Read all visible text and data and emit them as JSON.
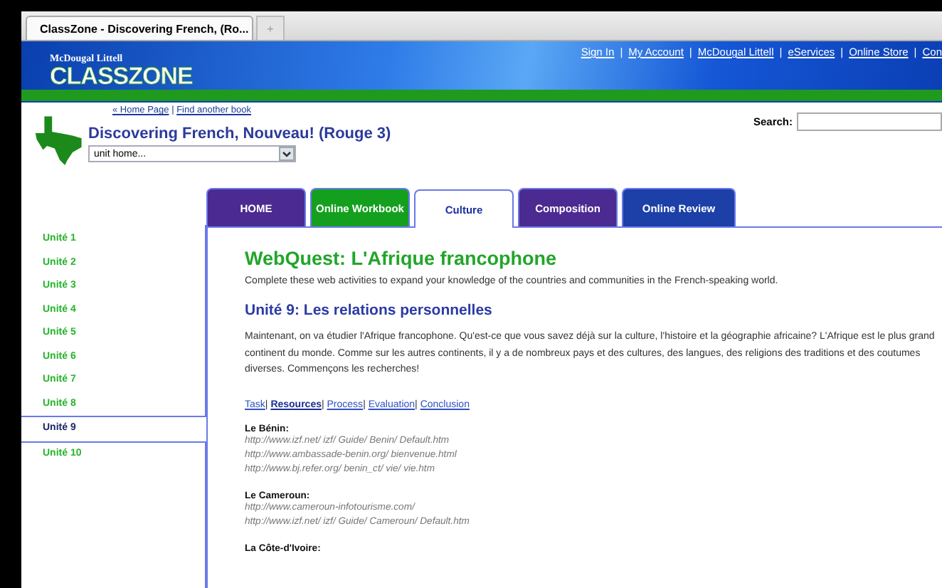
{
  "browser_tabs": [
    {
      "title": "ClassZone - Discovering French, (Ro...",
      "selected": true
    },
    {
      "title": "+",
      "selected": false
    }
  ],
  "header": {
    "publisher": "McDougal Littell",
    "logo": "CLASSZONE",
    "links": [
      "Sign In",
      "My Account",
      "McDougal Littell",
      "eServices",
      "Online Store",
      "Con"
    ],
    "separator": "|"
  },
  "breadcrumb": {
    "links": [
      {
        "label": "« Home Page"
      },
      {
        "label": "Find another book"
      }
    ],
    "separator": "|"
  },
  "book_title": "Discovering French, Nouveau! (Rouge 3)",
  "unit_select": {
    "value": "unit home..."
  },
  "search": {
    "label": "Search:"
  },
  "tabs": [
    {
      "label": "HOME",
      "color": "#4b2a91",
      "selected": false
    },
    {
      "label": "Online Workbook",
      "color": "#14a01e",
      "selected": false
    },
    {
      "label": "Culture",
      "color": "#ffffff",
      "selected": true
    },
    {
      "label": "Composition",
      "color": "#4b2a91",
      "selected": false
    },
    {
      "label": "Online Review",
      "color": "#1c3fa8",
      "selected": false
    }
  ],
  "units": [
    {
      "label": "Unité 1",
      "selected": false
    },
    {
      "label": "Unité 2",
      "selected": false
    },
    {
      "label": "Unité 3",
      "selected": false
    },
    {
      "label": "Unité 4",
      "selected": false
    },
    {
      "label": "Unité 5",
      "selected": false
    },
    {
      "label": "Unité 6",
      "selected": false
    },
    {
      "label": "Unité 7",
      "selected": false
    },
    {
      "label": "Unité 8",
      "selected": false
    },
    {
      "label": "Unité 9",
      "selected": true
    },
    {
      "label": "Unité 10",
      "selected": false
    }
  ],
  "content": {
    "title": "WebQuest: L'Afrique francophone",
    "intro": "Complete these web activities to expand your knowledge of the countries and communities in the French-speaking world.",
    "unit_heading": "Unité 9: Les relations personnelles",
    "paragraph": "Maintenant, on va étudier l'Afrique francophone. Qu'est-ce que vous savez déjà sur la culture, l'histoire et la géographie africaine? L'Afrique est le plus grand continent du monde. Comme sur les autres continents, il y a de nombreux pays et des cultures, des langues, des religions des traditions et des coutumes diverses. Commençons les recherches!",
    "section_separator": "|",
    "sections": [
      {
        "label": "Task",
        "selected": false
      },
      {
        "label": "Resources",
        "selected": true
      },
      {
        "label": "Process",
        "selected": false
      },
      {
        "label": "Evaluation",
        "selected": false
      },
      {
        "label": "Conclusion",
        "selected": false
      }
    ],
    "resources": [
      {
        "country": "Le Bénin:",
        "urls": [
          "http://www.izf.net/ izf/ Guide/ Benin/ Default.htm",
          "http://www.ambassade-benin.org/ bienvenue.html",
          "http://www.bj.refer.org/ benin_ct/ vie/ vie.htm"
        ]
      },
      {
        "country": "Le Cameroun:",
        "urls": [
          "http://www.cameroun-infotourisme.com/",
          "http://www.izf.net/ izf/ Guide/ Cameroun/ Default.htm"
        ]
      },
      {
        "country": "La Côte-d'Ivoire:"
      }
    ]
  }
}
